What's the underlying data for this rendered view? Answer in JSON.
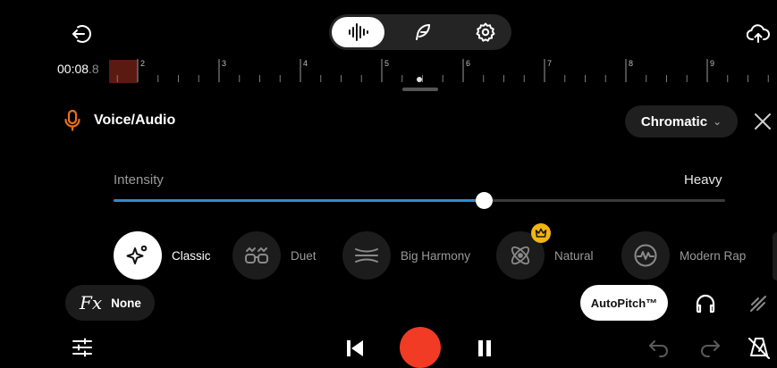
{
  "top_bar": {
    "back_icon": "exit-icon",
    "modes": [
      {
        "icon": "waveform-icon",
        "active": true
      },
      {
        "icon": "feather-icon",
        "active": false
      },
      {
        "icon": "gear-icon",
        "active": false
      }
    ],
    "upload_icon": "cloud-upload-icon"
  },
  "timeline": {
    "time_main": "00:08",
    "time_fraction": ".8",
    "ruler_marks": [
      "2",
      "3",
      "4",
      "5",
      "6",
      "7",
      "8",
      "9"
    ]
  },
  "track": {
    "icon": "microphone-icon",
    "name": "Voice/Audio",
    "scale": "Chromatic",
    "scale_chevron": "⌄",
    "close_icon": "close-icon"
  },
  "intensity": {
    "label": "Intensity",
    "value_label": "Heavy",
    "level": 0.606
  },
  "presets": [
    {
      "label": "Classic",
      "icon": "sparkle-icon",
      "active": true,
      "premium": false
    },
    {
      "label": "Duet",
      "icon": "duet-glasses-icon",
      "active": false,
      "premium": false
    },
    {
      "label": "Big Harmony",
      "icon": "harmony-lines-icon",
      "active": false,
      "premium": false
    },
    {
      "label": "Natural",
      "icon": "atom-icon",
      "active": false,
      "premium": true
    },
    {
      "label": "Modern Rap",
      "icon": "wave-circle-icon",
      "active": false,
      "premium": false
    }
  ],
  "fx": {
    "symbol": "Fx",
    "value": "None"
  },
  "autopitch": {
    "label": "AutoPitch™"
  },
  "colors": {
    "accent_blue": "#2d8bd6",
    "record_red": "#f23b24",
    "mic_orange": "#e8701a",
    "premium_gold": "#f2b611"
  }
}
